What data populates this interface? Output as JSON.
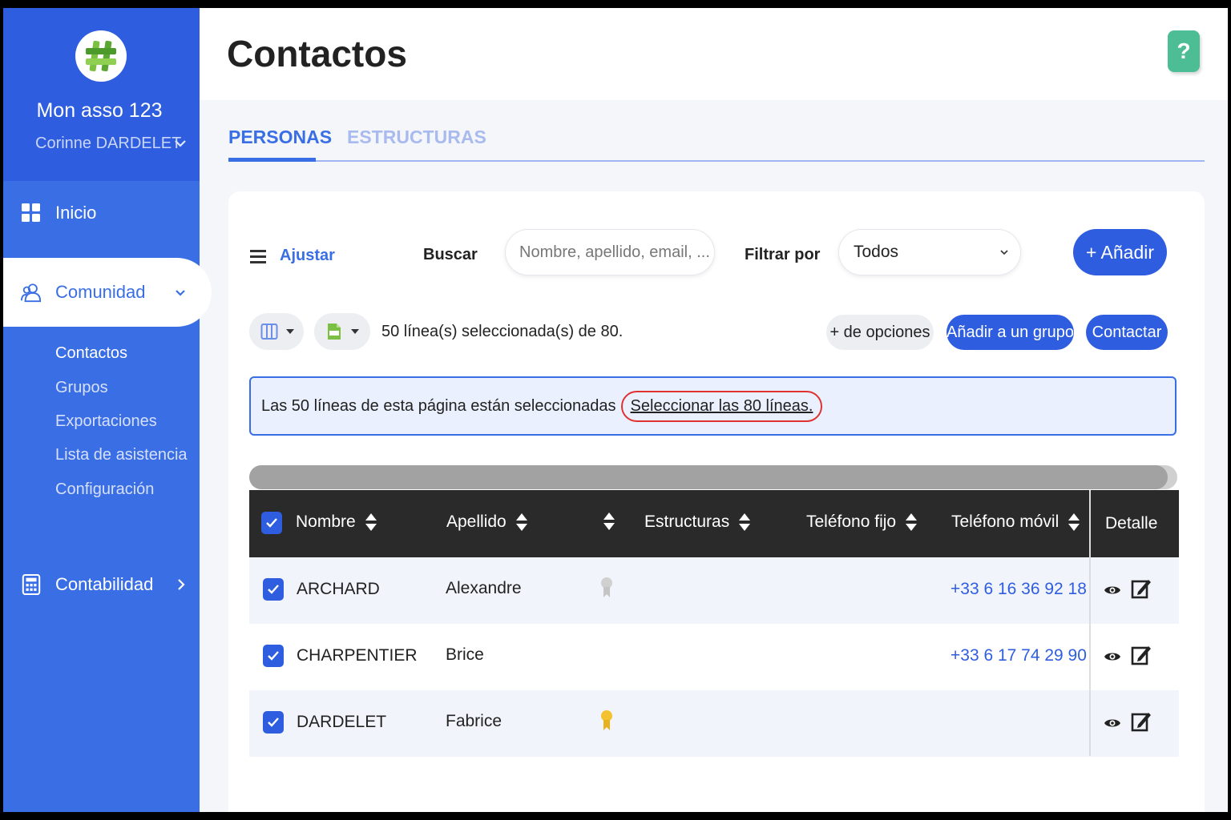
{
  "sidebar": {
    "org_name": "Mon asso 123",
    "user_name": "Corinne DARDELET",
    "nav": {
      "inicio": "Inicio",
      "comunidad": "Comunidad",
      "contabilidad": "Contabilidad"
    },
    "sub_items": [
      "Contactos",
      "Grupos",
      "Exportaciones",
      "Lista de asistencia",
      "Configuración"
    ]
  },
  "header": {
    "title": "Contactos",
    "help": "?"
  },
  "tabs": [
    "PERSONAS",
    "ESTRUCTURAS"
  ],
  "toolbar": {
    "ajustar": "Ajustar",
    "buscar_label": "Buscar",
    "search_placeholder": "Nombre, apellido, email, ...",
    "filter_label": "Filtrar por",
    "filter_value": "Todos",
    "add": "+ Añadir"
  },
  "selection": {
    "count_text": "50 línea(s) seleccionada(s) de 80.",
    "more_options": "+ de opciones",
    "add_to_group": "Añadir a un grupo",
    "contact": "Contactar",
    "banner_text": "Las 50 líneas de esta página están seleccionadas",
    "select_all_link": "Seleccionar las 80 líneas."
  },
  "table": {
    "headers": {
      "nombre": "Nombre",
      "apellido": "Apellido",
      "estructuras": "Estructuras",
      "fijo": "Teléfono fijo",
      "movil": "Teléfono móvil",
      "detalle": "Detalle"
    },
    "rows": [
      {
        "nombre": "ARCHARD",
        "apellido": "Alexandre",
        "badge": "silver",
        "movil": "+33 6 16 36 92 18"
      },
      {
        "nombre": "CHARPENTIER",
        "apellido": "Brice",
        "badge": "",
        "movil": "+33 6 17 74 29 90"
      },
      {
        "nombre": "DARDELET",
        "apellido": "Fabrice",
        "badge": "gold",
        "movil": ""
      }
    ]
  },
  "colors": {
    "primary": "#2f5de0",
    "sidebar": "#3a6ee4",
    "help": "#4cbd95",
    "highlight": "#e03131"
  }
}
